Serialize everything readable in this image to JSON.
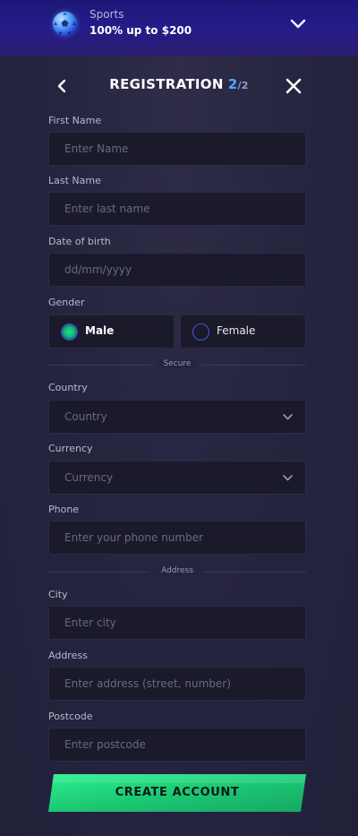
{
  "promo": {
    "category": "Sports",
    "offer": "100% up to $200",
    "icon": "soccer-ball-icon"
  },
  "header": {
    "title": "REGISTRATION",
    "step": "2",
    "total": "/2"
  },
  "fields": {
    "first_name": {
      "label": "First Name",
      "placeholder": "Enter Name"
    },
    "last_name": {
      "label": "Last Name",
      "placeholder": "Enter last name"
    },
    "dob": {
      "label": "Date of birth",
      "placeholder": "dd/mm/yyyy"
    },
    "gender": {
      "label": "Gender",
      "options": [
        "Male",
        "Female"
      ],
      "selected": "Male"
    },
    "country": {
      "label": "Country",
      "placeholder": "Country"
    },
    "currency": {
      "label": "Currency",
      "placeholder": "Currency"
    },
    "phone": {
      "label": "Phone",
      "placeholder": "Enter your phone number"
    },
    "city": {
      "label": "City",
      "placeholder": "Enter city"
    },
    "address": {
      "label": "Address",
      "placeholder": "Enter address (street, number)"
    },
    "postcode": {
      "label": "Postcode",
      "placeholder": "Enter postcode"
    }
  },
  "separators": {
    "secure": "Secure",
    "address": "Address"
  },
  "cta": {
    "label": "CREATE ACCOUNT"
  },
  "colors": {
    "accent_blue": "#4aa8ff",
    "cta_green": "#1fd17a",
    "promo_bg": "#1c1876",
    "panel_bg": "#23223a",
    "field_bg": "#1a1a2b"
  }
}
